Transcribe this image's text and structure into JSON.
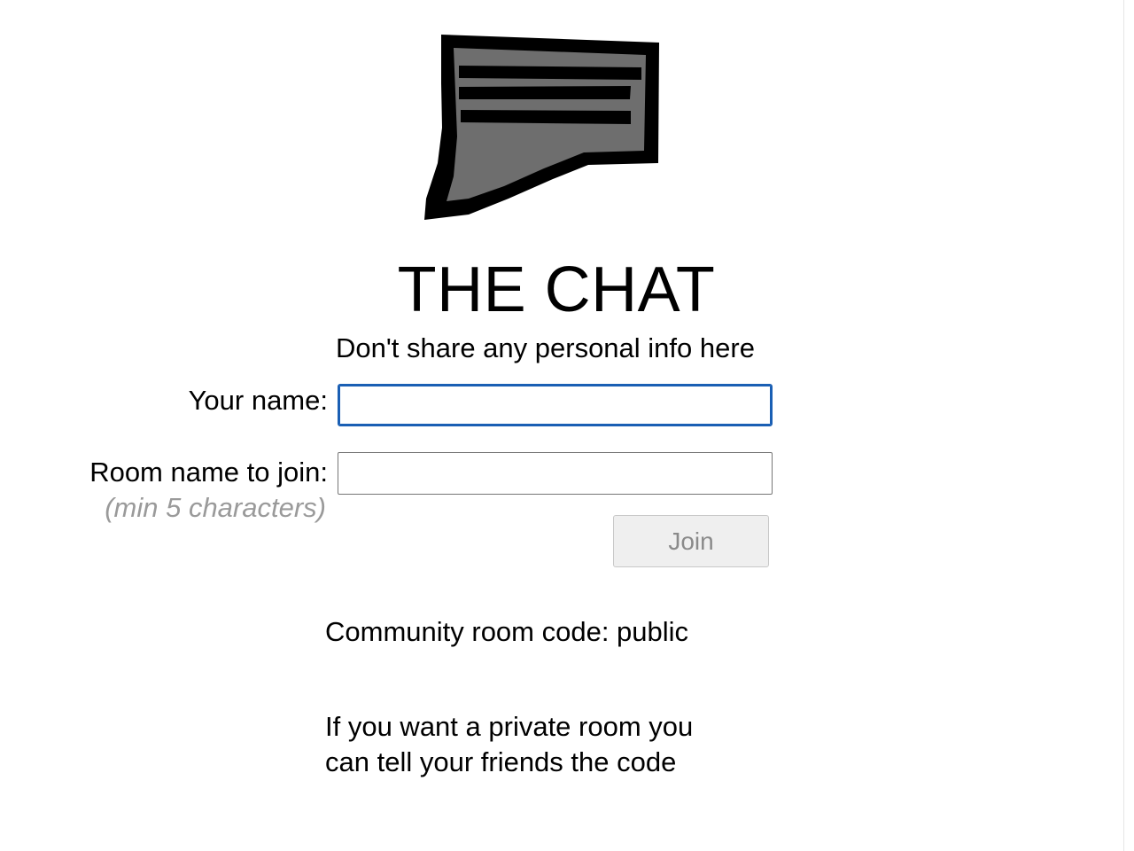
{
  "app": {
    "logo_icon": "chat-bubble-icon",
    "title": "THE CHAT",
    "subtitle": "Don't share any personal info here"
  },
  "form": {
    "name_label": "Your name:",
    "name_value": "",
    "room_label": "Room name to join:",
    "room_hint": "(min 5 characters)",
    "room_value": "",
    "join_label": "Join",
    "join_enabled": false
  },
  "info": {
    "community_code": "Community room code: public",
    "private_line1": "If you want a private room you",
    "private_line2": "can tell your friends the code"
  },
  "colors": {
    "focus_border": "#1a5fb4",
    "hint_text": "#9a9a9a",
    "disabled_button_bg": "#efefef",
    "disabled_button_text": "#8a8a8a",
    "logo_fill": "#6e6e6e",
    "logo_outline": "#000000"
  }
}
